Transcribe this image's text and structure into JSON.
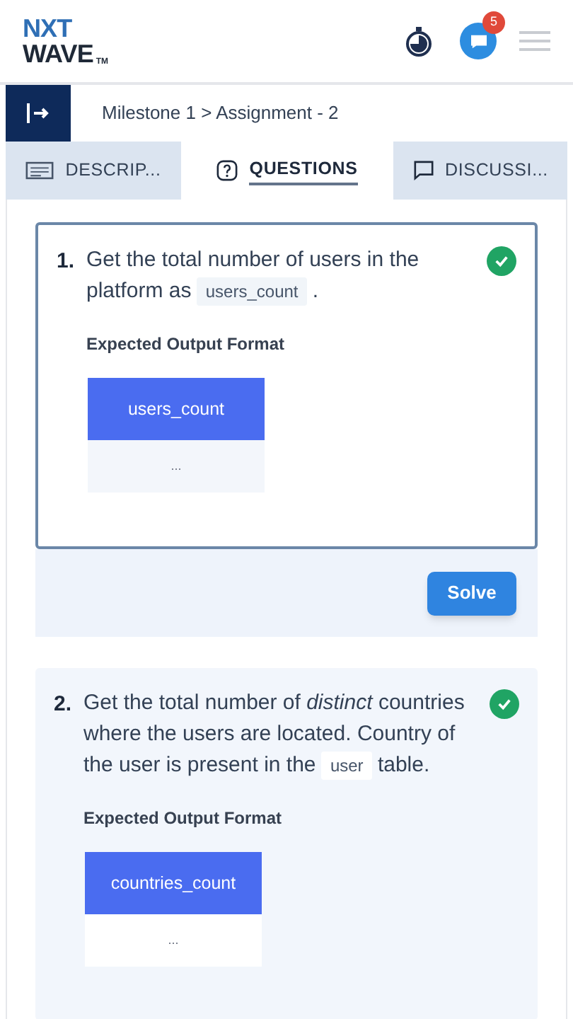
{
  "header": {
    "logo_top": "NXT",
    "logo_bottom": "WAVE",
    "logo_tm": "TM",
    "notification_count": "5"
  },
  "breadcrumb": "Milestone 1 > Assignment - 2",
  "tabs": [
    {
      "kind": "description",
      "label": "DESCRIP...",
      "selected": false
    },
    {
      "kind": "questions",
      "label": "QUESTIONS",
      "selected": true
    },
    {
      "kind": "discussion",
      "label": "DISCUSSI...",
      "selected": false
    }
  ],
  "questions": [
    {
      "number": "1.",
      "selected": true,
      "completed": true,
      "segments": [
        {
          "kind": "text",
          "text": "Get the total number of users in the platform as "
        },
        {
          "kind": "code",
          "text": "users_count"
        },
        {
          "kind": "text",
          "text": " ."
        }
      ],
      "output_label": "Expected Output Format",
      "output_column": "users_count",
      "output_cell": "...",
      "solve_button": "Solve"
    },
    {
      "number": "2.",
      "selected": false,
      "completed": true,
      "segments": [
        {
          "kind": "text",
          "text": "Get the total number of *distinct* countries where the users are located. Country of the user is present in the "
        },
        {
          "kind": "code",
          "text": "user"
        },
        {
          "kind": "text",
          "text": " table."
        }
      ],
      "output_label": "Expected Output Format",
      "output_column": "countries_count",
      "output_cell": "..."
    }
  ]
}
